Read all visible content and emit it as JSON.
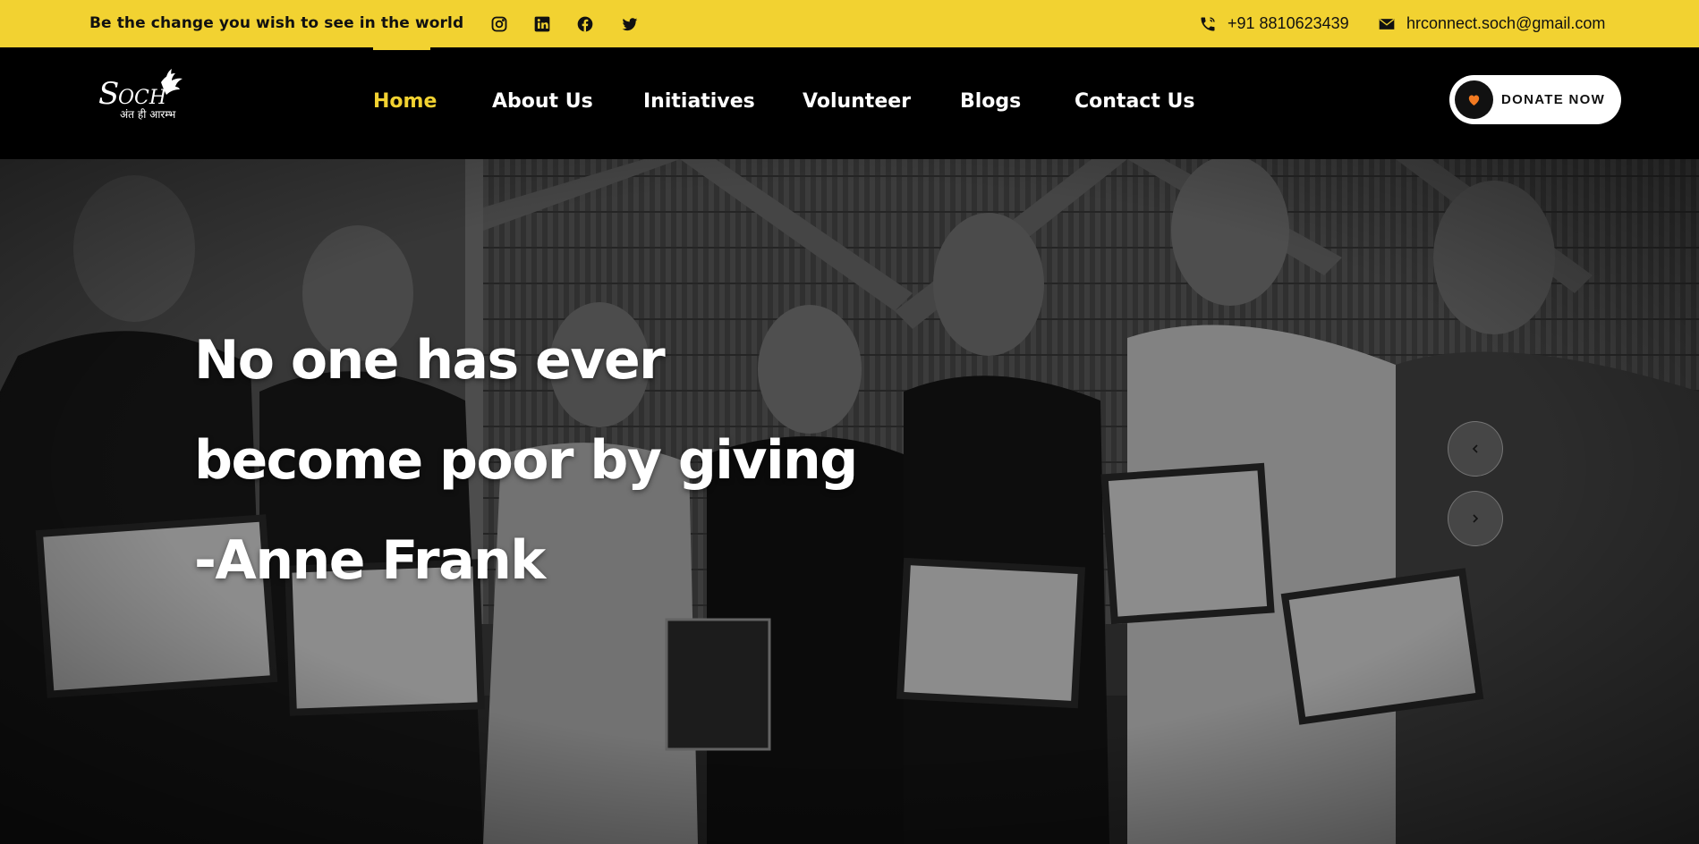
{
  "topbar": {
    "tagline": "Be the change you wish to see in the world",
    "social": [
      {
        "icon": "instagram-icon"
      },
      {
        "icon": "linkedin-icon"
      },
      {
        "icon": "facebook-icon"
      },
      {
        "icon": "twitter-icon"
      }
    ],
    "phone": "+91 8810623439",
    "email": "hrconnect.soch@gmail.com"
  },
  "header": {
    "logo": {
      "name": "Soch",
      "tagline": "अंत ही आरम्भ"
    },
    "nav": [
      {
        "label": "Home",
        "active": true
      },
      {
        "label": "About Us",
        "active": false
      },
      {
        "label": "Initiatives",
        "active": false
      },
      {
        "label": "Volunteer",
        "active": false
      },
      {
        "label": "Blogs",
        "active": false
      },
      {
        "label": "Contact Us",
        "active": false
      }
    ],
    "donate_label": "DONATE NOW"
  },
  "hero": {
    "quote_lines": [
      "No one has ever",
      "become poor by giving",
      "-Anne Frank"
    ]
  },
  "colors": {
    "accent_yellow": "#f2d231",
    "header_bg": "#000000",
    "donate_heart": "#f27a21"
  }
}
